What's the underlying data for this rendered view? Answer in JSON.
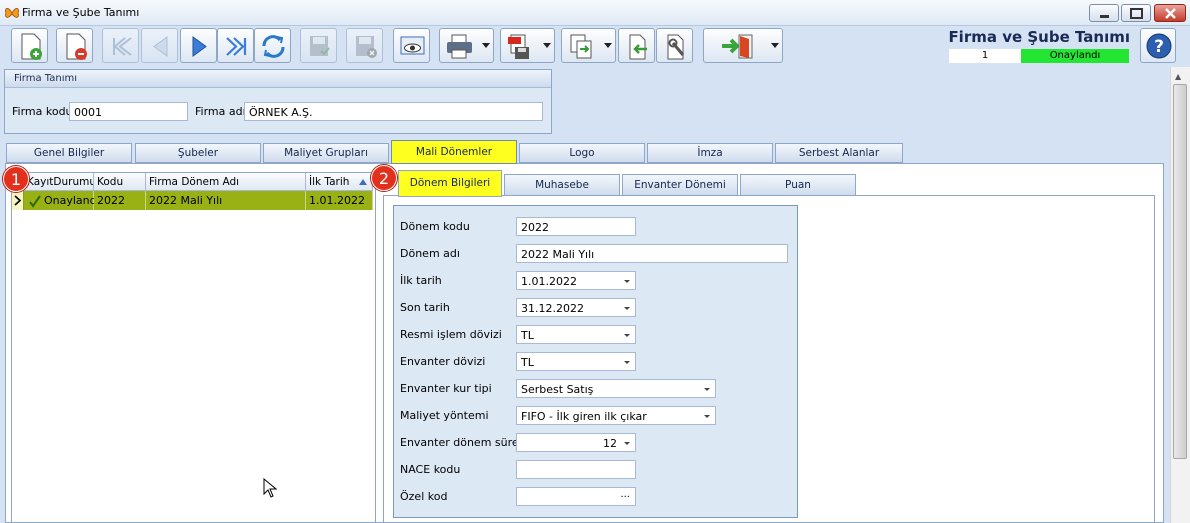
{
  "window": {
    "title": "Firma ve Şube Tanımı"
  },
  "toolbar": {
    "buttons": [
      "new-icon",
      "delete-icon",
      "first-icon",
      "prev-icon",
      "next-icon",
      "last-icon",
      "refresh-icon",
      "save-icon",
      "cancel-save-icon",
      "preview-icon",
      "print-icon",
      "pdf-icon",
      "export-icon",
      "import-icon",
      "settings-icon",
      "exit-icon"
    ]
  },
  "header": {
    "title": "Firma ve Şube Tanımı",
    "record_no": "1",
    "status": "Onaylandı",
    "status_color": "#22e632"
  },
  "firma": {
    "group_title": "Firma Tanımı",
    "code_label": "Firma kodu",
    "code_value": "0001",
    "name_label": "Firma adı",
    "name_value": "ÖRNEK A.Ş."
  },
  "tabs": [
    {
      "label": "Genel Bilgiler"
    },
    {
      "label": "Şubeler"
    },
    {
      "label": "Maliyet Grupları"
    },
    {
      "label": "Mali Dönemler"
    },
    {
      "label": "Logo"
    },
    {
      "label": "İmza"
    },
    {
      "label": "Serbest Alanlar"
    }
  ],
  "grid": {
    "columns": [
      "KayıtDurumu",
      "Kodu",
      "Firma Dönem Adı",
      "İlk Tarih"
    ],
    "rows": [
      {
        "status": "Onaylandı",
        "code": "2022",
        "name": "2022 Mali Yılı",
        "start": "1.01.2022"
      }
    ]
  },
  "badges": [
    "1",
    "2"
  ],
  "subtabs": [
    {
      "label": "Dönem Bilgileri"
    },
    {
      "label": "Muhasebe"
    },
    {
      "label": "Envanter Dönemi"
    },
    {
      "label": "Puan"
    }
  ],
  "form": {
    "donem_kodu": {
      "label": "Dönem kodu",
      "value": "2022"
    },
    "donem_adi": {
      "label": "Dönem adı",
      "value": "2022 Mali Yılı"
    },
    "ilk_tarih": {
      "label": "İlk tarih",
      "value": "1.01.2022"
    },
    "son_tarih": {
      "label": "Son tarih",
      "value": "31.12.2022"
    },
    "resmi_doviz": {
      "label": "Resmi işlem dövizi",
      "value": "TL"
    },
    "envanter_doviz": {
      "label": "Envanter dövizi",
      "value": "TL"
    },
    "kur_tipi": {
      "label": "Envanter kur tipi",
      "value": "Serbest Satış"
    },
    "maliyet_yontemi": {
      "label": "Maliyet yöntemi",
      "value": "FIFO - İlk giren ilk çıkar"
    },
    "donem_suresi": {
      "label": "Envanter dönem süresi",
      "value": "12"
    },
    "nace_kodu": {
      "label": "NACE kodu",
      "value": ""
    },
    "ozel_kod": {
      "label": "Özel kod",
      "value": "",
      "ellipsis": "..."
    }
  }
}
